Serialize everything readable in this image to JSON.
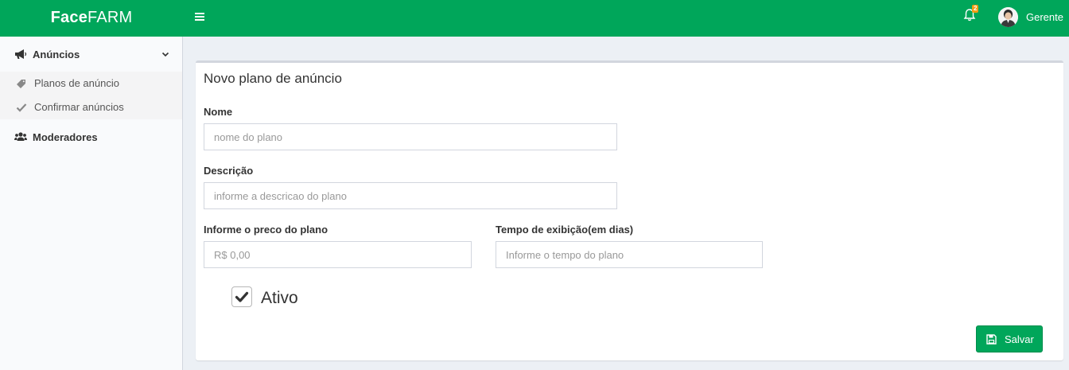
{
  "header": {
    "logo_bold": "Face",
    "logo_rest": "FARM",
    "notification_count": "2",
    "user_name": "Gerente",
    "menu_icon": "hamburger-icon",
    "bell_icon": "bell-icon",
    "brand_color": "#00a65a",
    "badge_color": "#f39c12"
  },
  "sidebar": {
    "items": [
      {
        "label": "Anúncios",
        "icon": "megaphone-icon",
        "expanded": true,
        "children": [
          {
            "label": "Planos de anúncio",
            "icon": "tag-icon"
          },
          {
            "label": "Confirmar anúncios",
            "icon": "check-icon"
          }
        ]
      },
      {
        "label": "Moderadores",
        "icon": "users-icon"
      }
    ]
  },
  "form": {
    "title": "Novo plano de anúncio",
    "nome_label": "Nome",
    "nome_placeholder": "nome do plano",
    "descricao_label": "Descrição",
    "descricao_placeholder": "informe a descricao do plano",
    "preco_label": "Informe o preco do plano",
    "preco_placeholder": "R$ 0,00",
    "tempo_label": "Tempo de exibição(em dias)",
    "tempo_placeholder": "Informe o tempo do plano",
    "ativo_label": "Ativo",
    "ativo_checked": true,
    "save_label": "Salvar"
  }
}
